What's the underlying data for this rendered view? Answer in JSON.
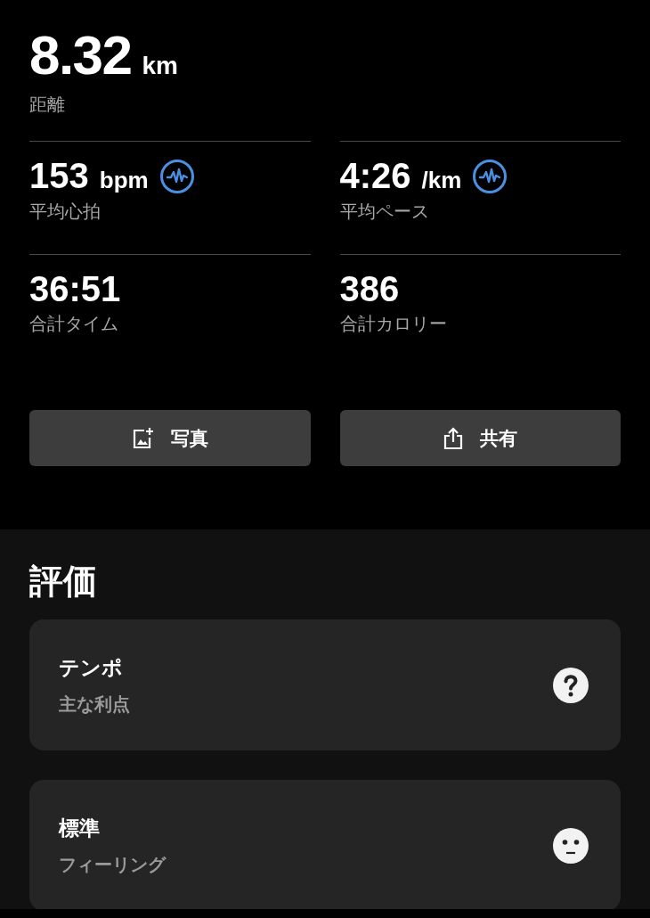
{
  "distance": {
    "value": "8.32",
    "unit": "km",
    "label": "距離"
  },
  "stats": [
    {
      "value": "153",
      "unit": "bpm",
      "label": "平均心拍",
      "trend_icon": true
    },
    {
      "value": "4:26",
      "unit": "/km",
      "label": "平均ペース",
      "trend_icon": true
    },
    {
      "value": "36:51",
      "label": "合計タイム",
      "trend_icon": false
    },
    {
      "value": "386",
      "label": "合計カロリー",
      "trend_icon": false
    }
  ],
  "actions": [
    {
      "kind": "photo",
      "label": "写真"
    },
    {
      "kind": "share",
      "label": "共有"
    }
  ],
  "rating": {
    "title": "評価",
    "cards": [
      {
        "title": "テンポ",
        "subtitle": "主な利点",
        "kind": "question"
      },
      {
        "title": "標準",
        "subtitle": "フィーリング",
        "kind": "neutral-face"
      }
    ]
  }
}
